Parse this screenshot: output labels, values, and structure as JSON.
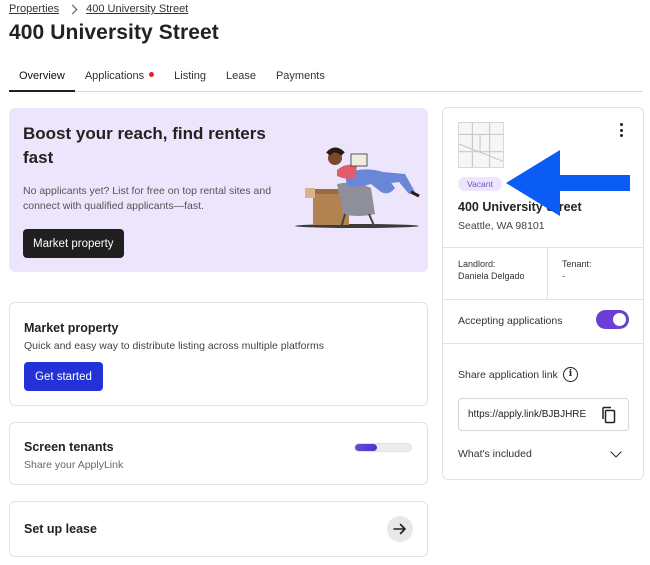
{
  "breadcrumb": {
    "root": "Properties",
    "current": "400 University Street"
  },
  "page": {
    "title": "400 University Street"
  },
  "tabs": [
    {
      "label": "Overview",
      "active": true
    },
    {
      "label": "Applications",
      "dot": true
    },
    {
      "label": "Listing"
    },
    {
      "label": "Lease"
    },
    {
      "label": "Payments"
    }
  ],
  "promo": {
    "title": "Boost your reach, find renters fast",
    "body": "No applicants yet? List for free on top rental sites and connect with qualified applicants—fast.",
    "button": "Market property"
  },
  "market": {
    "title": "Market property",
    "subtitle": "Quick and easy way to distribute listing across multiple platforms",
    "button": "Get started"
  },
  "screen": {
    "title": "Screen tenants",
    "subtitle": "Share your ApplyLink",
    "progress": 0.4
  },
  "lease": {
    "title": "Set up lease"
  },
  "property": {
    "status": "Vacant",
    "address": "400 University Street",
    "city": "Seattle, WA 98101",
    "landlord_label": "Landlord:",
    "landlord": "Daniela Delgado",
    "tenant_label": "Tenant:",
    "tenant": "-",
    "accepting_label": "Accepting applications",
    "accepting": true,
    "share_label": "Share application link",
    "share_url": "https://apply.link/BJBJHRE",
    "included_label": "What's included"
  },
  "colors": {
    "accent_purple": "#6a3fd6",
    "primary_blue": "#2232d6",
    "promo_bg": "#ece5fb",
    "annotation_arrow": "#0a5cf5"
  },
  "icons": [
    "chevron-right-icon",
    "kebab-menu-icon",
    "info-icon",
    "copy-icon",
    "chevron-down-icon",
    "arrow-right-icon"
  ]
}
